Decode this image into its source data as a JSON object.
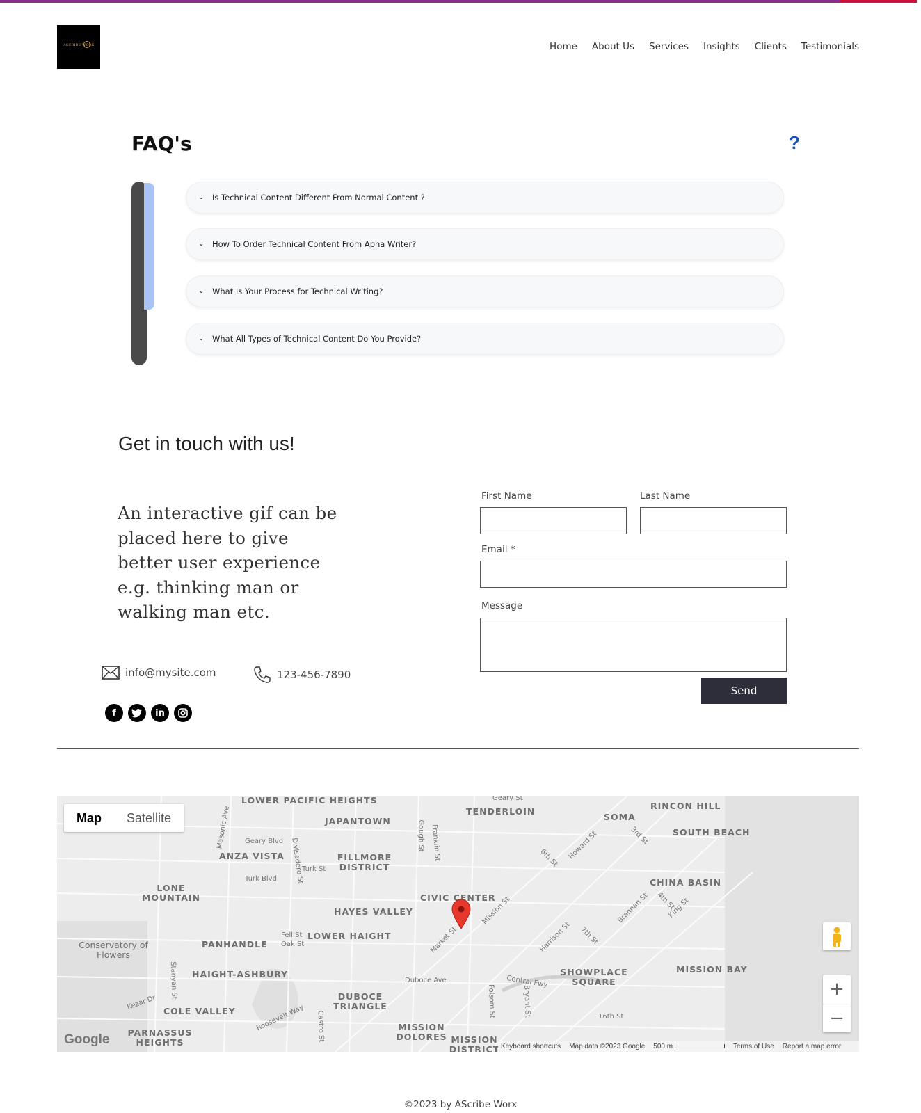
{
  "nav": [
    "Home",
    "About Us",
    "Services",
    "Insights",
    "Clients",
    "Testimonials"
  ],
  "logo": {
    "text": "ASCRIBE WORX"
  },
  "faq": {
    "title": "FAQ's",
    "icon": "?",
    "items": [
      "Is Technical Content Different From Normal Content ?",
      "How To Order Technical Content From Apna Writer?",
      "What Is Your Process for Technical Writing?",
      "What All Types of Technical Content Do You Provide?"
    ]
  },
  "contact": {
    "title": "Get in touch with us!",
    "promo": "An interactive gif can be placed here to give better user experience e.g. thinking man or walking man etc.",
    "email": "info@mysite.com",
    "phone": "123-456-7890",
    "socials": [
      "f",
      "t",
      "in",
      "ig"
    ]
  },
  "form": {
    "first_name_label": "First Name",
    "last_name_label": "Last Name",
    "email_label": "Email *",
    "message_label": "Message",
    "first_name_value": "",
    "last_name_value": "",
    "email_value": "",
    "message_value": "",
    "send_label": "Send"
  },
  "map": {
    "tabs": [
      "Map",
      "Satellite"
    ],
    "labels": [
      "LOWER PACIFIC HEIGHTS",
      "TENDERLOIN",
      "RINCON HILL",
      "SOMA",
      "SOUTH BEACH",
      "JAPANTOWN",
      "ANZA VISTA",
      "FILLMORE DISTRICT",
      "LONE MOUNTAIN",
      "CHINA BASIN",
      "CIVIC CENTER",
      "HAYES VALLEY",
      "PANHANDLE",
      "LOWER HAIGHT",
      "HAIGHT-ASHBURY",
      "SHOWPLACE SQUARE",
      "MISSION BAY",
      "COLE VALLEY",
      "DUBOCE TRIANGLE",
      "MISSION DOLORES",
      "PARNASSUS HEIGHTS",
      "MISSION DISTRICT",
      "Conservatory of Flowers"
    ],
    "streets": [
      "Geary Blvd",
      "Turk St",
      "Turk Blvd",
      "Gough St",
      "Franklin St",
      "Divisadero St",
      "Fell St",
      "Oak St",
      "Market St",
      "Mission St",
      "Duboce Ave",
      "Central Fwy",
      "Folsom St",
      "Bryant St",
      "16th St",
      "Harrison St",
      "Howard St",
      "6th St",
      "7th St",
      "Brannan St",
      "4th St",
      "King St",
      "3rd St",
      "Kezar Dr",
      "Stanyan St",
      "Castro St",
      "Roosevelt Way",
      "Masonic Ave",
      "Geary St"
    ],
    "footer": [
      "Keyboard shortcuts",
      "Map data ©2023 Google",
      "500 m",
      "Terms of Use",
      "Report a map error"
    ],
    "google": "Google",
    "zoom_in": "+",
    "zoom_out": "−"
  },
  "footer": {
    "copyright": "©2023 by AScribe Worx"
  }
}
